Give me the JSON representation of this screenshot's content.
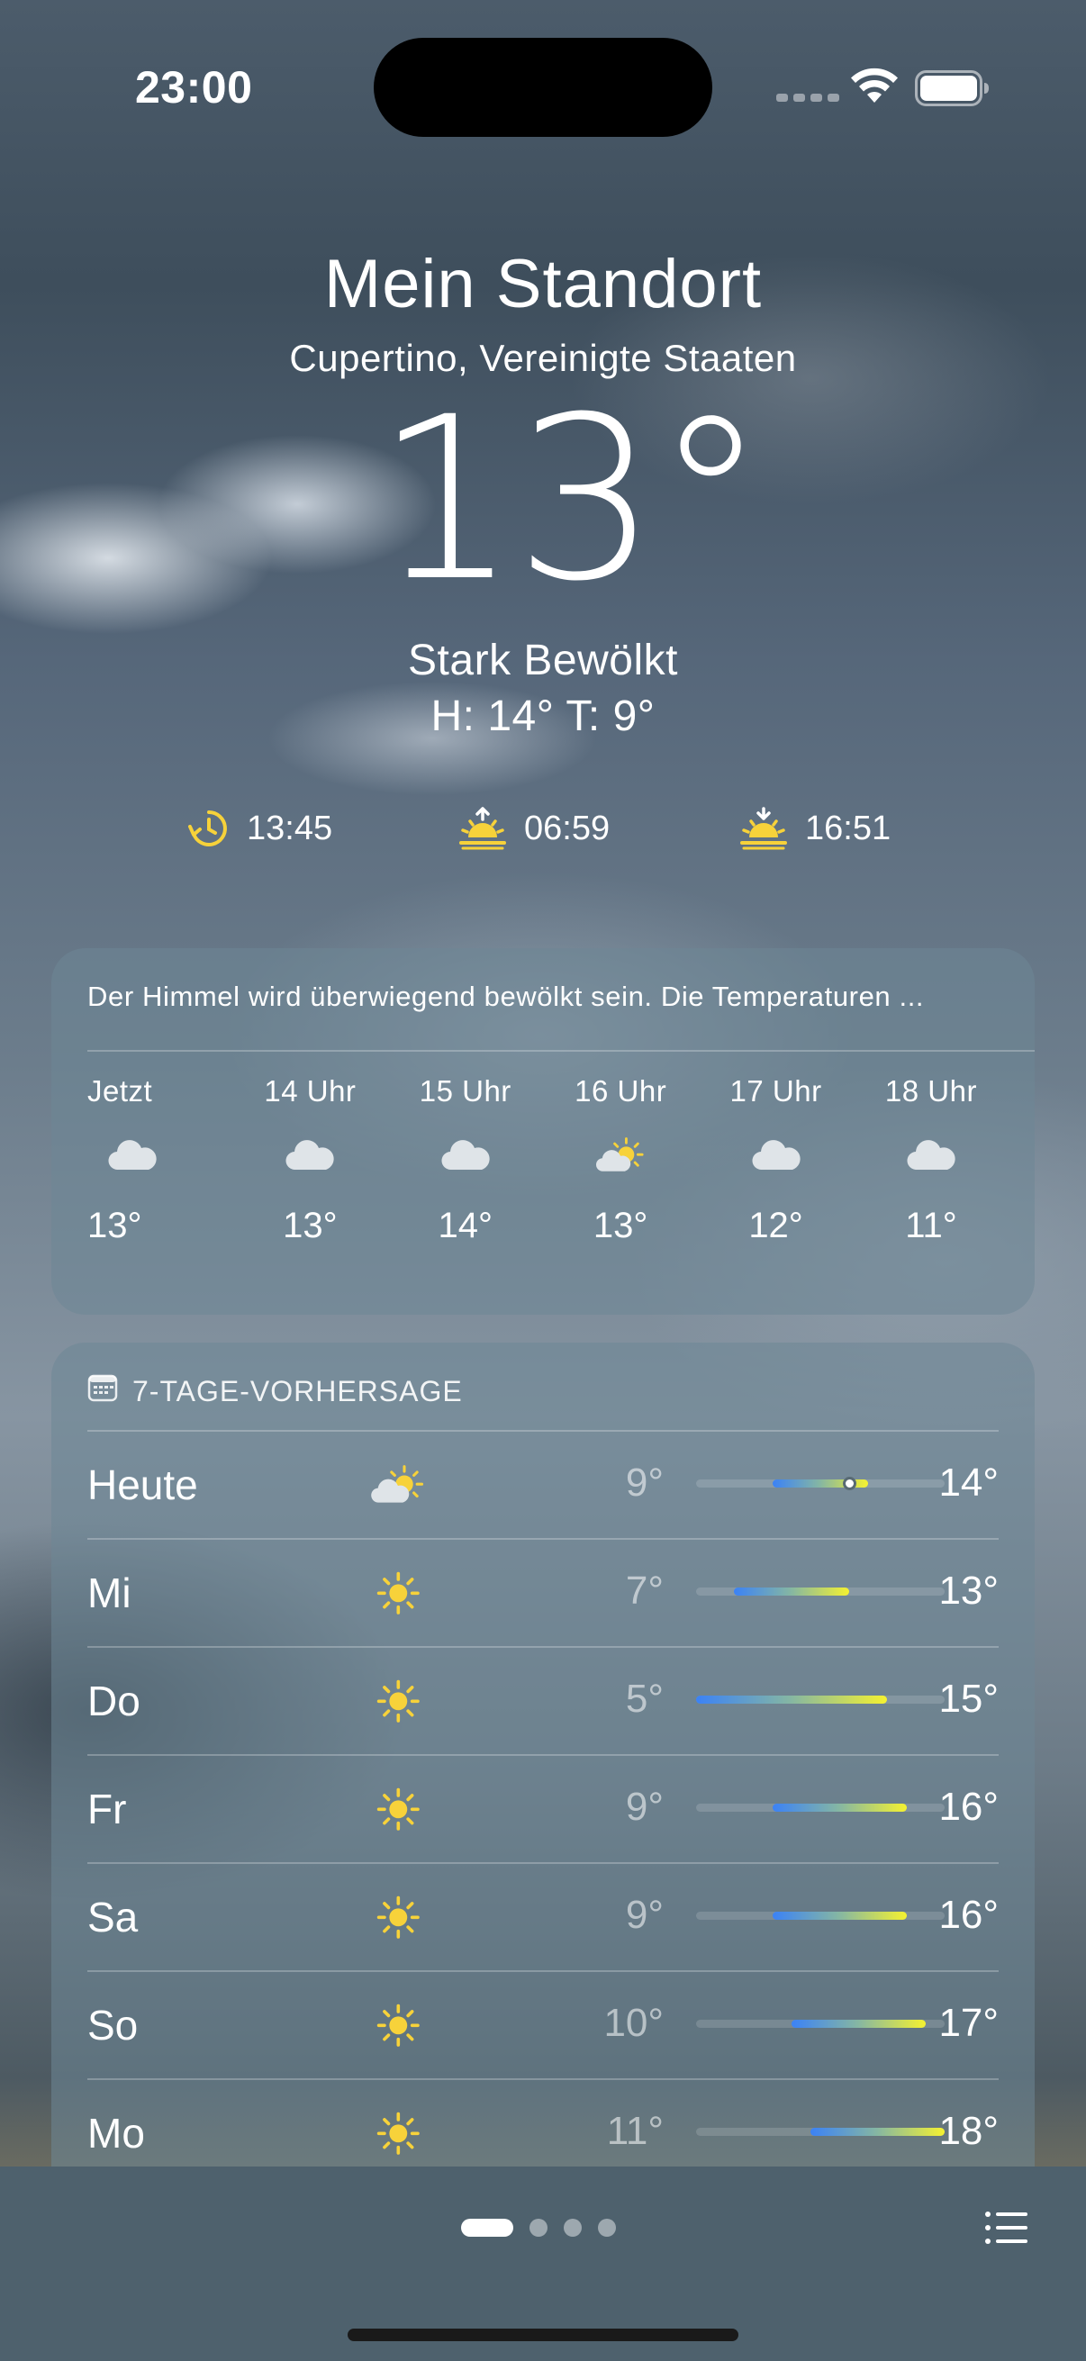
{
  "status_bar": {
    "time": "23:00"
  },
  "location": {
    "title": "Mein Standort",
    "subtitle": "Cupertino, Vereinigte Staaten"
  },
  "current": {
    "temperature": "13°",
    "condition": "Stark Bewölkt",
    "high_low": "H: 14° T: 9°"
  },
  "sun_times": [
    {
      "icon": "golden-hour-icon",
      "time": "13:45"
    },
    {
      "icon": "sunrise-icon",
      "time": "06:59"
    },
    {
      "icon": "sunset-icon",
      "time": "16:51"
    }
  ],
  "hourly": {
    "summary": "Der Himmel wird überwiegend bewölkt sein. Die Temperaturen ...",
    "hours": [
      {
        "label": "Jetzt",
        "icon": "cloud-icon",
        "temp": "13°"
      },
      {
        "label": "14 Uhr",
        "icon": "cloud-icon",
        "temp": "13°"
      },
      {
        "label": "15 Uhr",
        "icon": "cloud-icon",
        "temp": "14°"
      },
      {
        "label": "16 Uhr",
        "icon": "partly-sunny-icon",
        "temp": "13°"
      },
      {
        "label": "17 Uhr",
        "icon": "cloud-icon",
        "temp": "12°"
      },
      {
        "label": "18 Uhr",
        "icon": "cloud-icon",
        "temp": "11°"
      }
    ]
  },
  "forecast": {
    "header": "7-TAGE-VORHERSAGE",
    "range_min": 5,
    "range_max": 18,
    "days": [
      {
        "name": "Heute",
        "icon": "partly-sunny-icon",
        "low": "9°",
        "high": "14°",
        "low_value": 9,
        "high_value": 14,
        "current_value": 13
      },
      {
        "name": "Mi",
        "icon": "sun-icon",
        "low": "7°",
        "high": "13°",
        "low_value": 7,
        "high_value": 13
      },
      {
        "name": "Do",
        "icon": "sun-icon",
        "low": "5°",
        "high": "15°",
        "low_value": 5,
        "high_value": 15
      },
      {
        "name": "Fr",
        "icon": "sun-icon",
        "low": "9°",
        "high": "16°",
        "low_value": 9,
        "high_value": 16
      },
      {
        "name": "Sa",
        "icon": "sun-icon",
        "low": "9°",
        "high": "16°",
        "low_value": 9,
        "high_value": 16
      },
      {
        "name": "So",
        "icon": "sun-icon",
        "low": "10°",
        "high": "17°",
        "low_value": 10,
        "high_value": 17
      },
      {
        "name": "Mo",
        "icon": "sun-icon",
        "low": "11°",
        "high": "18°",
        "low_value": 11,
        "high_value": 18
      }
    ]
  },
  "bottom_bar": {
    "page_count": 4,
    "active_page": 1,
    "list_icon": "list-icon"
  },
  "colors": {
    "sun_yellow": "#f7d23a",
    "bar_cold": "#3b82f6",
    "bar_warm": "#f5f230"
  }
}
